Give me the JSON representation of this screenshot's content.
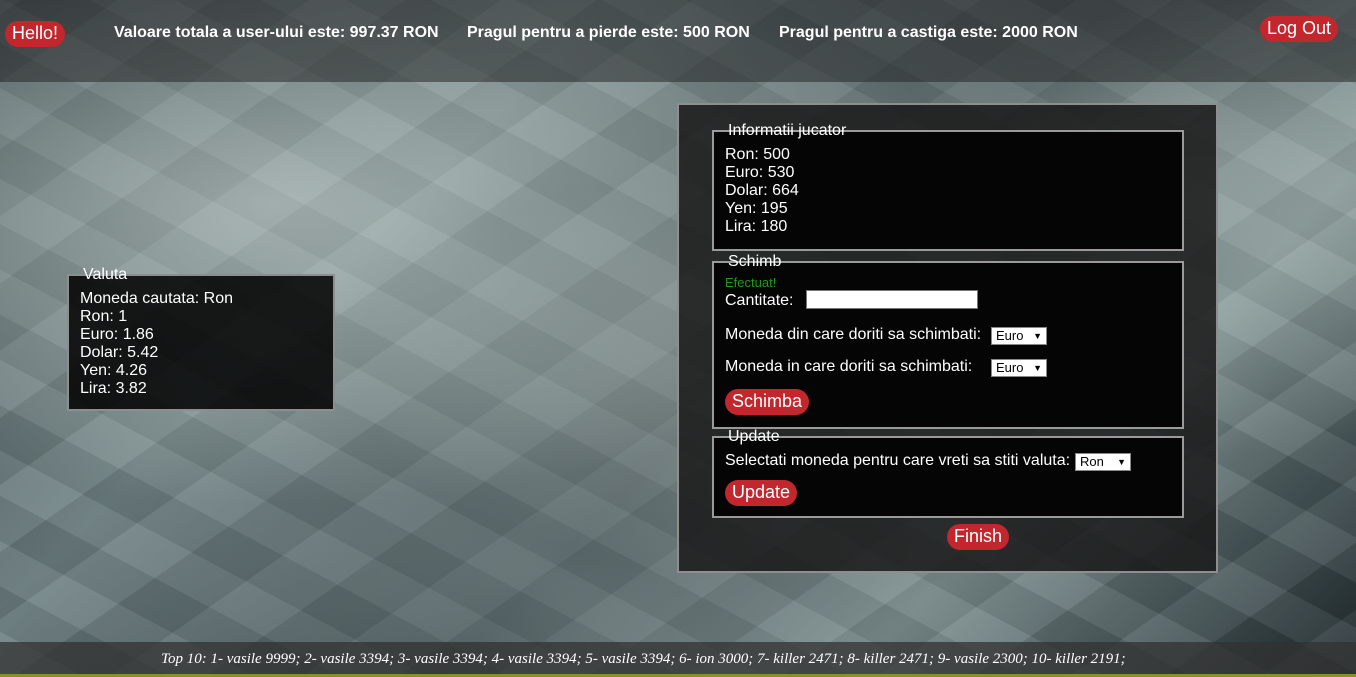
{
  "header": {
    "hello_label": "Hello!",
    "logout_label": "Log Out",
    "total_value": "Valoare totala a user-ului este: 997.37 RON",
    "lose_threshold": "Pragul pentru a pierde este: 500 RON",
    "win_threshold": "Pragul pentru a castiga este: 2000 RON"
  },
  "valuta": {
    "legend": "Valuta",
    "lines": [
      "Moneda cautata: Ron",
      "Ron: 1",
      "Euro: 1.86",
      "Dolar: 5.42",
      "Yen: 4.26",
      "Lira: 3.82"
    ]
  },
  "info": {
    "legend": "Informatii jucator",
    "lines": [
      "Ron: 500",
      "Euro: 530",
      "Dolar: 664",
      "Yen: 195",
      "Lira: 180"
    ]
  },
  "schimb": {
    "legend": "Schimb",
    "status": "Efectuat!",
    "quantity_label": "Cantitate:",
    "quantity_value": "",
    "from_label": "Moneda din care doriti sa schimbati:",
    "from_value": "Euro",
    "to_label": "Moneda in care doriti sa schimbati:",
    "to_value": "Euro",
    "button_label": "Schimba"
  },
  "update": {
    "legend": "Update",
    "select_label": "Selectati moneda pentru care vreti sa stiti valuta:",
    "select_value": "Ron",
    "button_label": "Update"
  },
  "finish_label": "Finish",
  "footer": {
    "top10": "Top 10: 1- vasile 9999; 2- vasile 3394; 3- vasile 3394; 4- vasile 3394; 5- vasile 3394; 6- ion 3000; 7- killer 2471; 8- killer 2471; 9- vasile 2300; 10- killer 2191;"
  },
  "colors": {
    "accent_button": "#c1272d",
    "success_text": "#1f9a1f",
    "panel_border": "#8e8e8e"
  },
  "icons": {
    "select_arrow": "chevron-down-icon"
  }
}
